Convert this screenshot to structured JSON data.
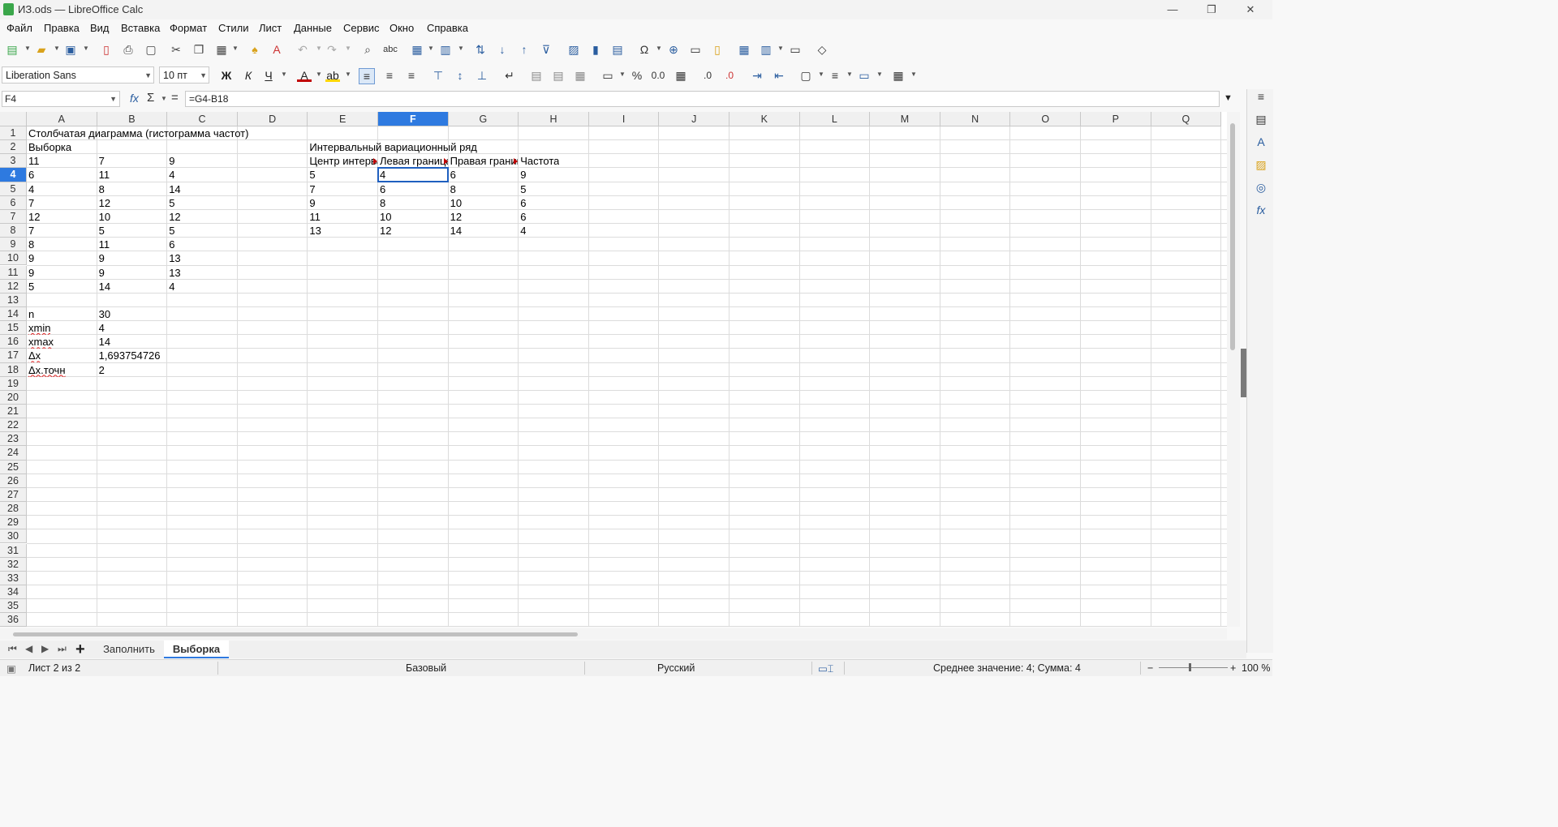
{
  "window": {
    "title": "ИЗ.ods — LibreOffice Calc",
    "minimize": "—",
    "maximize": "❐",
    "close": "✕"
  },
  "menu": [
    "Файл",
    "Правка",
    "Вид",
    "Вставка",
    "Формат",
    "Стили",
    "Лист",
    "Данные",
    "Сервис",
    "Окно",
    "Справка"
  ],
  "formatting": {
    "font_name": "Liberation Sans",
    "font_size": "10 пт",
    "bold": "Ж",
    "italic": "К",
    "underline": "Ч"
  },
  "formula_bar": {
    "cell_ref": "F4",
    "fx": "fx",
    "sum": "Σ",
    "equals": "=",
    "formula": "=G4-B18"
  },
  "columns": [
    "A",
    "B",
    "C",
    "D",
    "E",
    "F",
    "G",
    "H",
    "I",
    "J",
    "K",
    "L",
    "M",
    "N",
    "O",
    "P",
    "Q"
  ],
  "selected_column": "F",
  "selected_row": 4,
  "rows": [
    1,
    2,
    3,
    4,
    5,
    6,
    7,
    8,
    9,
    10,
    11,
    12,
    13,
    14,
    15,
    16,
    17,
    18,
    19,
    20,
    21,
    22,
    23,
    24,
    25,
    26,
    27,
    28,
    29,
    30,
    31,
    32,
    33,
    34,
    35,
    36
  ],
  "cells": {
    "A1": "Столбчатая диаграмма (гистограмма частот)",
    "A2": "Выборка",
    "E2": "Интервальный вариационный ряд",
    "A3": "11",
    "B3": "7",
    "C3": "9",
    "E3": "Центр интервала",
    "F3": "Левая граница",
    "G3": "Правая граница",
    "H3": "Частота",
    "A4": "6",
    "B4": "11",
    "C4": "4",
    "E4": "5",
    "F4": "4",
    "G4": "6",
    "H4": "9",
    "A5": "4",
    "B5": "8",
    "C5": "14",
    "E5": "7",
    "F5": "6",
    "G5": "8",
    "H5": "5",
    "A6": "7",
    "B6": "12",
    "C6": "5",
    "E6": "9",
    "F6": "8",
    "G6": "10",
    "H6": "6",
    "A7": "12",
    "B7": "10",
    "C7": "12",
    "E7": "11",
    "F7": "10",
    "G7": "12",
    "H7": "6",
    "A8": "7",
    "B8": "5",
    "C8": "5",
    "E8": "13",
    "F8": "12",
    "G8": "14",
    "H8": "4",
    "A9": "8",
    "B9": "11",
    "C9": "6",
    "A10": "9",
    "B10": "9",
    "C10": "13",
    "A11": "9",
    "B11": "9",
    "C11": "13",
    "A12": "5",
    "B12": "14",
    "C12": "4",
    "A14": "n",
    "B14": "30",
    "A15": "xmin",
    "B15": "4",
    "A16": "xmax",
    "B16": "14",
    "A17": "Δx",
    "B17": "1,693754726",
    "A18": "Δx.точн",
    "B18": "2"
  },
  "sheet_tabs": [
    {
      "label": "Заполнить",
      "active": false
    },
    {
      "label": "Выборка",
      "active": true
    }
  ],
  "add_sheet": "+",
  "status": {
    "sheet": "Лист 2 из 2",
    "style": "Базовый",
    "language": "Русский",
    "summary": "Среднее значение: 4; Сумма: 4",
    "zoom_minus": "−",
    "zoom_plus": "+",
    "zoom": "100 %"
  }
}
